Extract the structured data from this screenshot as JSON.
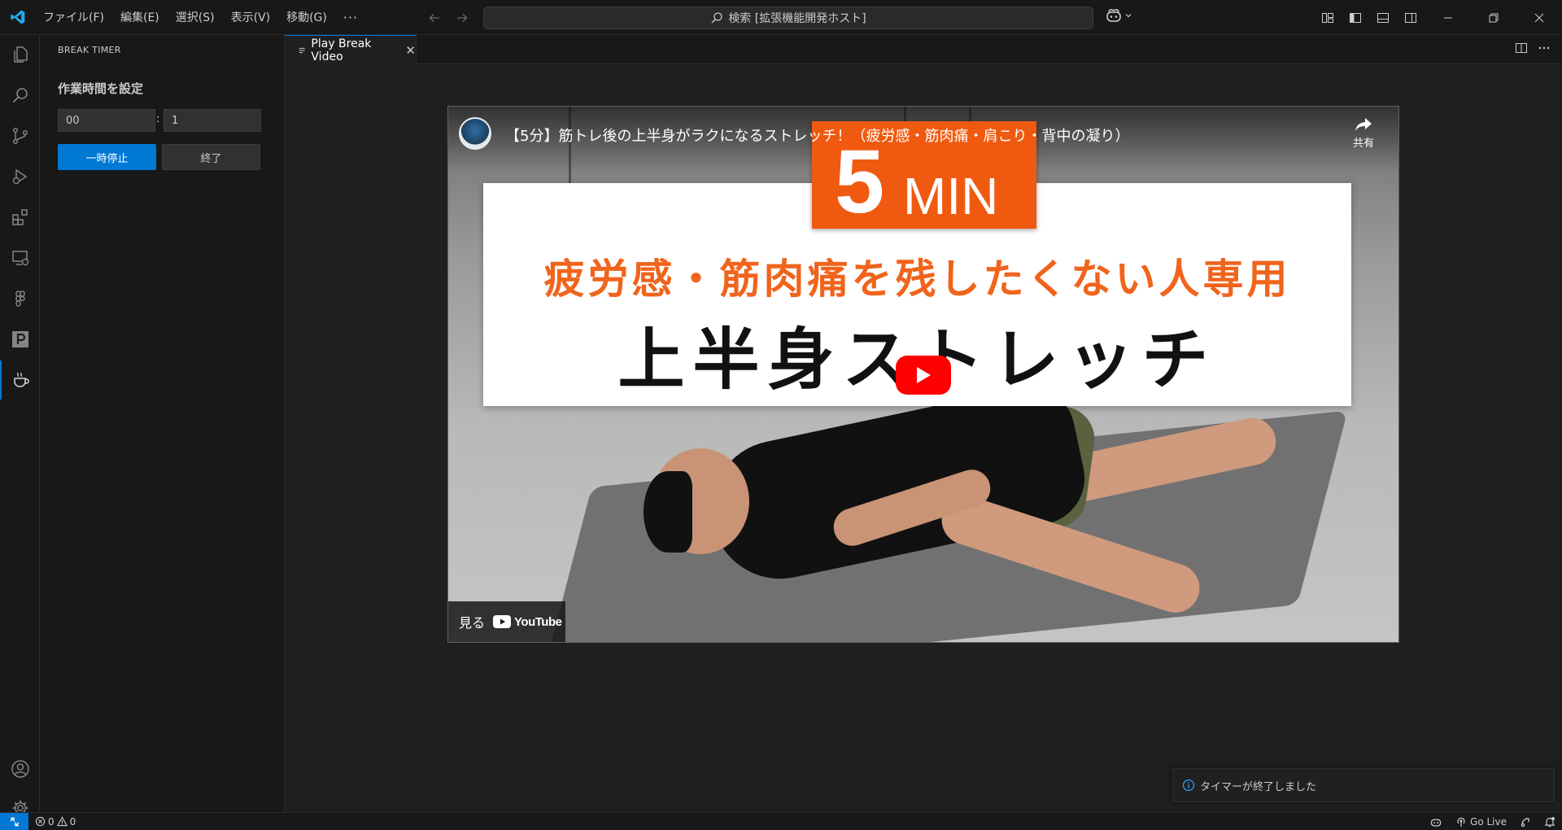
{
  "titlebar": {
    "menu": [
      "ファイル(F)",
      "編集(E)",
      "選択(S)",
      "表示(V)",
      "移動(G)"
    ],
    "more": "···",
    "search_text": "検索 [拡張機能開発ホスト]"
  },
  "activitybar": {
    "items": [
      "explorer",
      "search",
      "source-control",
      "run-and-debug",
      "extensions",
      "remote-explorer",
      "figma",
      "p-extension",
      "break-timer"
    ],
    "active": "break-timer",
    "bottom": [
      "accounts",
      "manage"
    ]
  },
  "sidebar": {
    "title": "BREAK TIMER",
    "heading": "作業時間を設定",
    "hours_value": "00",
    "separator": ":",
    "minutes_value": "1",
    "pause_label": "一時停止",
    "end_label": "終了"
  },
  "editor": {
    "tab_label": "Play Break Video",
    "tab_close": "✕"
  },
  "video": {
    "title": "【5分】筋トレ後の上半身がラクになるストレッチ！（疲労感・筋肉痛・肩こり・背中の凝り）",
    "share_label": "共有",
    "badge_number": "5",
    "badge_unit": "MIN",
    "banner_line1": "疲労感・筋肉痛を残したくない人専用",
    "banner_line2": "上半身ストレッチ",
    "watch_on_label": "見る",
    "youtube_label": "YouTube"
  },
  "notification": {
    "text": "タイマーが終了しました"
  },
  "statusbar": {
    "errors": "0",
    "warnings": "0",
    "go_live": "Go Live"
  },
  "colors": {
    "accent": "#0078d4",
    "orange": "#f05a10",
    "youtube_red": "#ff0000"
  }
}
